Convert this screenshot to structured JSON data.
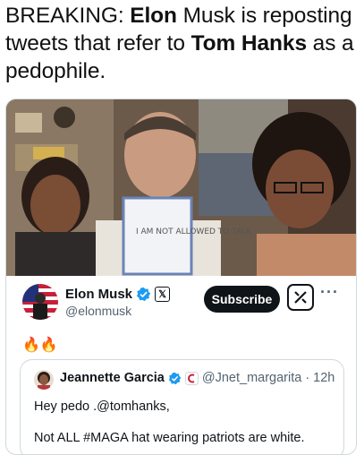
{
  "headline": {
    "prefix": "BREAKING: ",
    "bold1": "Elon",
    "mid1": " Musk is reposting tweets that refer to ",
    "bold2": "Tom Hanks",
    "suffix": " as a pedophile."
  },
  "tweet": {
    "author_name": "Elon Musk",
    "author_handle": "@elonmusk",
    "subscribe_label": "Subscribe",
    "more_label": "···",
    "emojis": "🔥🔥"
  },
  "quote": {
    "author_name": "Jeannette Garcia",
    "author_handle": "@Jnet_margarita",
    "time": "· 12h",
    "line1": "Hey pedo .@tomhanks,",
    "line2": "Not ALL #MAGA hat wearing patriots are white."
  },
  "photo": {
    "sign_text": "I AM NOT ALLOWED TO TALK"
  },
  "colors": {
    "verified_blue": "#1d9bf0",
    "text": "#0f1419",
    "muted": "#536471",
    "border": "#cfd9de"
  },
  "icons": [
    "verified-badge-icon",
    "x-affiliate-icon",
    "grok-icon",
    "more-icon",
    "fire-emoji"
  ]
}
